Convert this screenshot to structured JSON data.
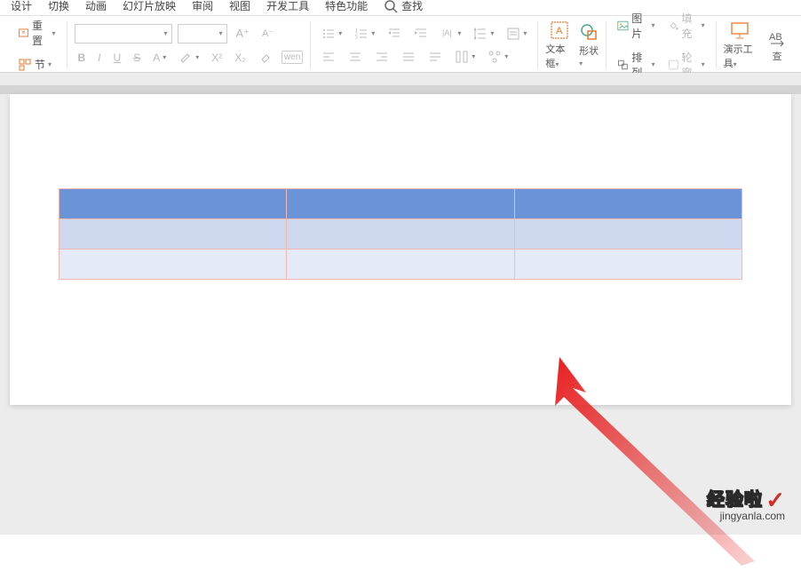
{
  "menu": {
    "design": "设计",
    "switch": "切换",
    "animation": "动画",
    "slideshow": "幻灯片放映",
    "review": "审阅",
    "view": "视图",
    "devtools": "开发工具",
    "features": "特色功能",
    "search": "查找"
  },
  "ribbon": {
    "reset": "重置",
    "section": "节",
    "font_name": "",
    "font_size": "",
    "textbox": "文本框",
    "shapes": "形状",
    "picture": "图片",
    "arrange": "排列",
    "fill": "填充",
    "outline": "轮廓",
    "present_tools": "演示工具"
  },
  "icons": {
    "reset": "reset-icon",
    "section": "section-icon",
    "bold": "B",
    "italic": "I",
    "underline": "U",
    "strike": "S",
    "fontcolor": "A",
    "super": "X²",
    "sub": "X₂",
    "pinyin": "wen"
  },
  "watermark": {
    "title": "经验啦",
    "url": "jingyanla.com",
    "check": "✓"
  }
}
